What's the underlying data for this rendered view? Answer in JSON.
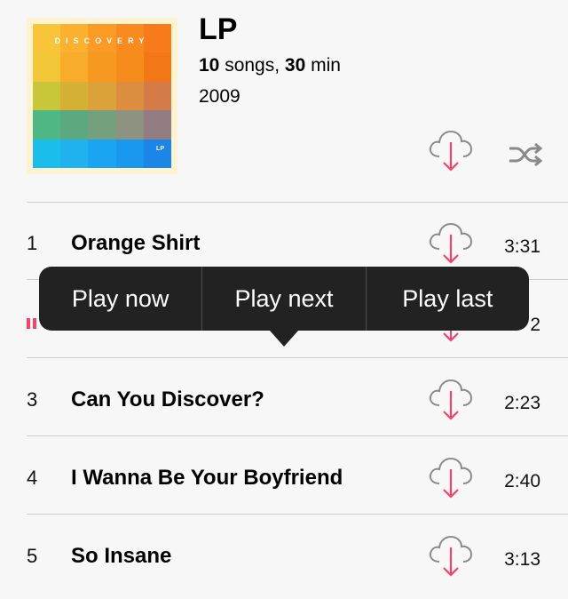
{
  "album": {
    "title": "LP",
    "song_count": "10",
    "songs_label": " songs, ",
    "duration": "30",
    "duration_label": " min",
    "year": "2009",
    "artwork": {
      "brand_text": "DISCOVERY",
      "corner_text": "LP"
    }
  },
  "icons": {
    "download": "cloud-download-icon",
    "shuffle": "shuffle-icon",
    "now_playing": "now-playing-icon"
  },
  "colors": {
    "accent": "#f4426c",
    "popup_bg": "#222222"
  },
  "tracks": [
    {
      "number": "1",
      "title": "Orange Shirt",
      "duration": "3:31"
    },
    {
      "number": "",
      "title": "",
      "duration": "2"
    },
    {
      "number": "3",
      "title": "Can You Discover?",
      "duration": "2:23"
    },
    {
      "number": "4",
      "title": "I Wanna Be Your Boyfriend",
      "duration": "2:40"
    },
    {
      "number": "5",
      "title": "So Insane",
      "duration": "3:13"
    }
  ],
  "context_menu": {
    "options": [
      "Play now",
      "Play next",
      "Play last"
    ]
  }
}
